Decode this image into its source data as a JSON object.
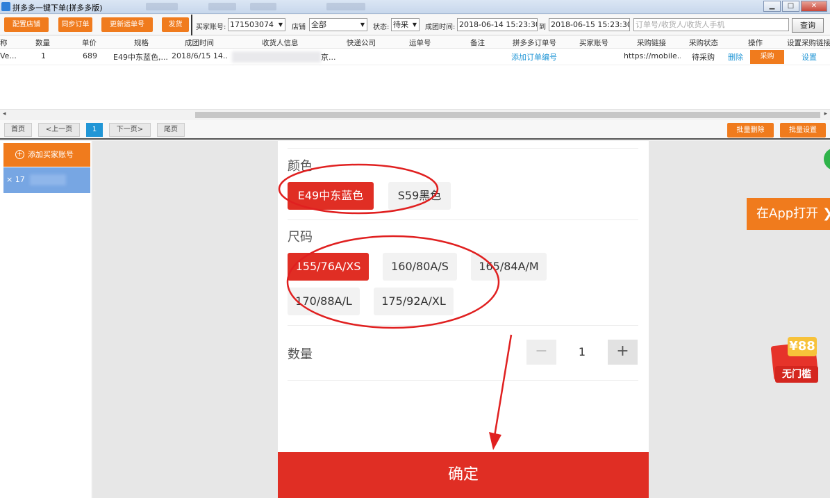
{
  "window": {
    "title": "拼多多一键下单(拼多多版)",
    "buttons": [
      "▁",
      "□",
      "✕"
    ]
  },
  "toolbar": {
    "config_store": "配置店铺",
    "sync_orders": "同步订单",
    "update_tracking": "更新运单号",
    "ship": "发货",
    "buyer_account_label": "买家账号:",
    "buyer_account_value": "171503074",
    "store_label": "店铺",
    "store_value": "全部",
    "status_label": "状态:",
    "status_value": "待采",
    "group_time_label": "成团时间:",
    "start_time": "2018-06-14 15:23:30",
    "to_label": "到",
    "end_time": "2018-06-15 15:23:30",
    "search_placeholder": "订单号/收货人/收货人手机",
    "query_button": "查询"
  },
  "grid": {
    "headers": [
      "称",
      "数量",
      "单价",
      "规格",
      "成团时间",
      "收货人信息",
      "快递公司",
      "运单号",
      "备注",
      "拼多多订单号",
      "买家账号",
      "采购链接",
      "采购状态",
      "操作",
      "设置采购链接"
    ],
    "row": {
      "name": "Ve...",
      "quantity": "1",
      "price": "689",
      "spec": "E49中东蓝色,...",
      "group_time": "2018/6/15 14...",
      "receiver_suffix": "京...",
      "add_order_no": "添加订单编号",
      "purchase_link": "https://mobile...",
      "purchase_status": "待采购",
      "delete": "删除",
      "purchase": "采购",
      "settings": "设置"
    }
  },
  "pager": {
    "first": "首页",
    "prev": "<上一页",
    "current": "1",
    "next": "下一页>",
    "last": "尾页",
    "batch_delete": "批量删除",
    "batch_settings": "批量设置"
  },
  "left_panel": {
    "add_account": "添加买家账号",
    "account_prefix": "× 17"
  },
  "product": {
    "color_label": "颜色",
    "colors": [
      "E49中东蓝色",
      "S59黑色"
    ],
    "selected_color": "E49中东蓝色",
    "size_label": "尺码",
    "sizes": [
      "155/76A/XS",
      "160/80A/S",
      "165/84A/M",
      "170/88A/L",
      "175/92A/XL"
    ],
    "selected_size": "155/76A/XS",
    "quantity_label": "数量",
    "quantity": "1",
    "minus": "−",
    "plus": "+",
    "confirm": "确定"
  },
  "side": {
    "open_in_app": "在App打开",
    "coupon_amount": "¥88",
    "coupon_text": "无门槛"
  },
  "colors": {
    "accent_orange": "#f07b1d",
    "pdd_red": "#e02e24",
    "link_blue": "#2196d6",
    "annotation_red": "#e02020"
  }
}
